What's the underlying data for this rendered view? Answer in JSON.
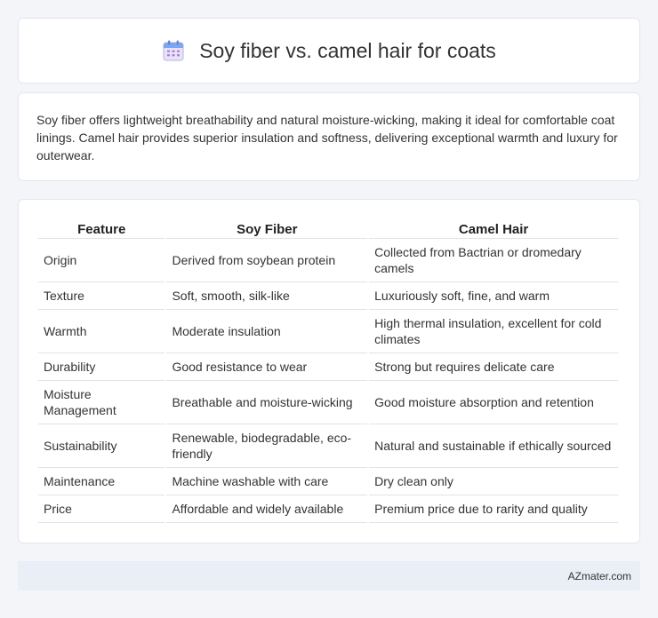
{
  "header": {
    "title": "Soy fiber vs. camel hair for coats",
    "icon": "calendar-icon"
  },
  "intro": {
    "text": "Soy fiber offers lightweight breathability and natural moisture-wicking, making it ideal for comfortable coat linings. Camel hair provides superior insulation and softness, delivering exceptional warmth and luxury for outerwear."
  },
  "table": {
    "headers": [
      "Feature",
      "Soy Fiber",
      "Camel Hair"
    ],
    "rows": [
      [
        "Origin",
        "Derived from soybean protein",
        "Collected from Bactrian or dromedary camels"
      ],
      [
        "Texture",
        "Soft, smooth, silk-like",
        "Luxuriously soft, fine, and warm"
      ],
      [
        "Warmth",
        "Moderate insulation",
        "High thermal insulation, excellent for cold climates"
      ],
      [
        "Durability",
        "Good resistance to wear",
        "Strong but requires delicate care"
      ],
      [
        "Moisture Management",
        "Breathable and moisture-wicking",
        "Good moisture absorption and retention"
      ],
      [
        "Sustainability",
        "Renewable, biodegradable, eco-friendly",
        "Natural and sustainable if ethically sourced"
      ],
      [
        "Maintenance",
        "Machine washable with care",
        "Dry clean only"
      ],
      [
        "Price",
        "Affordable and widely available",
        "Premium price due to rarity and quality"
      ]
    ]
  },
  "footer": {
    "brand": "AZmater.com"
  }
}
